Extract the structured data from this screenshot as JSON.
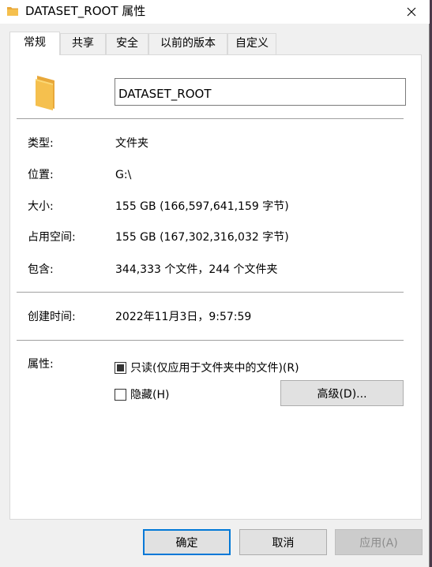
{
  "window": {
    "title": "DATASET_ROOT 属性"
  },
  "tabs": [
    {
      "label": "常规"
    },
    {
      "label": "共享"
    },
    {
      "label": "安全"
    },
    {
      "label": "以前的版本"
    },
    {
      "label": "自定义"
    }
  ],
  "general": {
    "folder_name": "DATASET_ROOT",
    "rows": [
      {
        "label": "类型:",
        "value": "文件夹"
      },
      {
        "label": "位置:",
        "value": "G:\\"
      },
      {
        "label": "大小:",
        "value": "155 GB (166,597,641,159 字节)"
      },
      {
        "label": "占用空间:",
        "value": "155 GB (167,302,316,032 字节)"
      },
      {
        "label": "包含:",
        "value": "344,333 个文件，244 个文件夹"
      }
    ],
    "created_label": "创建时间:",
    "created_value": "2022年11月3日，9:57:59",
    "attributes_label": "属性:",
    "readonly_label": "只读(仅应用于文件夹中的文件)(R)",
    "hidden_label": "隐藏(H)",
    "advanced_label": "高级(D)..."
  },
  "footer": {
    "ok": "确定",
    "cancel": "取消",
    "apply": "应用(A)"
  },
  "colors": {
    "accent": "#0078d7",
    "folder": "#f5c04e"
  }
}
